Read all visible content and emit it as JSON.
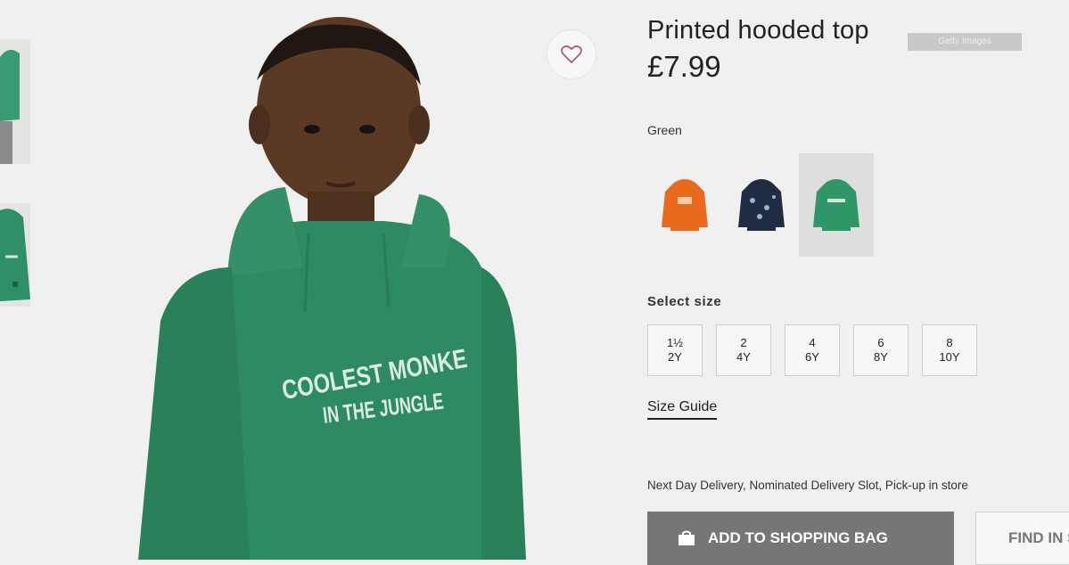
{
  "product": {
    "title": "Printed hooded top",
    "price": "£7.99",
    "watermark": "Getty Images",
    "hoodie_print_line1": "COOLEST MONKE",
    "hoodie_print_line2": "IN THE JUNGLE"
  },
  "colors": {
    "selected_label": "Green",
    "swatches": [
      {
        "name": "orange",
        "hex": "#e86a1d"
      },
      {
        "name": "navy",
        "hex": "#1f2c44"
      },
      {
        "name": "green",
        "hex": "#2f9668",
        "selected": true
      }
    ]
  },
  "sizes": {
    "label": "Select size",
    "options": [
      {
        "top": "1½",
        "bottom": "2Y"
      },
      {
        "top": "2",
        "bottom": "4Y"
      },
      {
        "top": "4",
        "bottom": "6Y"
      },
      {
        "top": "6",
        "bottom": "8Y"
      },
      {
        "top": "8",
        "bottom": "10Y"
      }
    ],
    "guide_label": "Size Guide"
  },
  "delivery_text": "Next Day Delivery, Nominated Delivery Slot, Pick-up in store",
  "actions": {
    "add_to_bag": "ADD TO SHOPPING BAG",
    "find_in_store": "FIND IN STORE"
  },
  "icons": {
    "favorite": "heart-icon",
    "bag": "shopping-bag-icon"
  }
}
